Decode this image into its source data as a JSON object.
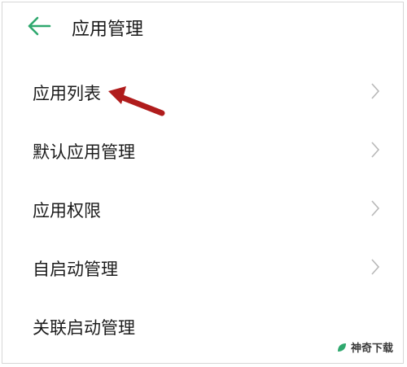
{
  "header": {
    "title": "应用管理"
  },
  "menu": {
    "items": [
      {
        "label": "应用列表"
      },
      {
        "label": "默认应用管理"
      },
      {
        "label": "应用权限"
      },
      {
        "label": "自启动管理"
      },
      {
        "label": "关联启动管理"
      }
    ]
  },
  "watermark": {
    "text": "神奇下载"
  },
  "colors": {
    "accent": "#2fa86e",
    "annotation": "#b01c1c",
    "text": "#1a1a1a",
    "chevron": "#b8b8b8"
  },
  "icons": {
    "back": "arrow-left-icon",
    "chevron": "chevron-right-icon",
    "annotation": "annotation-arrow-icon"
  }
}
